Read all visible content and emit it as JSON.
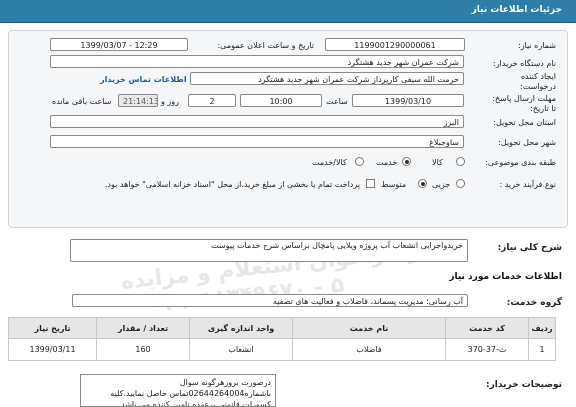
{
  "header": {
    "title": "جزئیات اطلاعات نیاز"
  },
  "form": {
    "need_number_label": "شماره نیاز:",
    "need_number_value": "1199001290000061",
    "announce_label": "تاریخ و ساعت اعلان عمومی:",
    "announce_value": "1399/03/07 - 12:29",
    "buyer_label": "نام دستگاه خریدار:",
    "buyer_value": "شرکت عمران شهر جدید هشتگرد",
    "creator_label": "ایجاد کننده درخواست:",
    "creator_value": "حرمت الله  سیفی کارپرداز شرکت عمران شهر جدید هشتگرد",
    "contact_link": "اطلاعات تماس خریدار",
    "deadline_label": "مهلت ارسال پاسخ: تا تاریخ:",
    "deadline_date": "1399/03/10",
    "hour_label": "ساعت",
    "deadline_time": "10:00",
    "days_value": "2",
    "days_label": "روز و",
    "remaining_time": "21:14:13",
    "remaining_label": "ساعت باقی مانده",
    "province_label": "استان محل تحویل:",
    "province_value": "البرز",
    "city_label": "شهر محل تحویل:",
    "city_value": "ساوجبلاغ",
    "category_label": "طبقه بندی موضوعی:",
    "category_options": [
      "کالا",
      "خدمت",
      "کالا/خدمت"
    ],
    "category_selected": "خدمت",
    "process_label": "نوع فرآیند خرید :",
    "process_options": [
      "جزیی",
      "متوسط"
    ],
    "process_selected": "متوسط",
    "payment_note": "پرداخت تمام یا بخشی از مبلغ خرید،از محل \"اسناد خزانه اسلامی\" خواهد بود."
  },
  "summary": {
    "label": "شرح کلی نیاز:",
    "value": "خریدواجرایی انشعاب آب پروژه ویلایی پامچال براساس شرح خدمات پیوست"
  },
  "services": {
    "section_title": "اطلاعات خدمات مورد نیاز",
    "group_label": "گروه خدمت:",
    "group_value": "آب رسانی؛ مدیریت پسماند، فاضلاب و فعالیت های تصفیه"
  },
  "table": {
    "headers": [
      "ردیف",
      "کد خدمت",
      "نام خدمت",
      "واحد اندازه گیری",
      "تعداد / مقدار",
      "تاریخ نیاز"
    ],
    "rows": [
      [
        "1",
        "ث-37-370",
        "فاضلاب",
        "انشعاب",
        "160",
        "1399/03/11"
      ]
    ]
  },
  "buyer_notes": {
    "label": "توضیحات خریدار:",
    "value": "درصورت بروزهرگونه سوال باشماره02644264004تماس حاصل نمایید.کلیه کسورات قانونی برعهده تامین کننده می باشد"
  },
  "watermarks": [
    "مرکز فراخوان استعلام و مزایده",
    "۰۲۱-۸۸۳۴۹۶۷۰ - ۵"
  ]
}
